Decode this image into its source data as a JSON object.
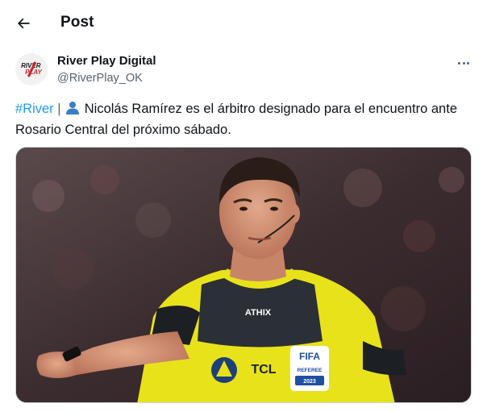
{
  "header": {
    "title": "Post",
    "back_icon": "arrow-left-icon"
  },
  "author": {
    "name": "River Play Digital",
    "handle": "@RiverPlay_OK",
    "avatar_text_line1": "RIVER",
    "avatar_text_line2": "PLAY",
    "more_icon": "more-horizontal-icon"
  },
  "tweet": {
    "hashtag": "#River",
    "separator": " | ",
    "emoji_icon": "bust-in-silhouette-icon",
    "text": " Nicolás Ramírez es el árbitro designado para el encuentro ante Rosario Central del próximo sábado."
  },
  "media": {
    "alt": "Referee photo",
    "jersey_brand": "ATHIX",
    "sponsor": "TCL",
    "badge_title": "FIFA",
    "badge_subtitle": "REFEREE",
    "badge_year": "2023"
  },
  "colors": {
    "accent": "#1d9bf0",
    "text_primary": "#0f1419",
    "text_secondary": "#536471",
    "jersey_yellow": "#e8e21a",
    "jersey_dark": "#2b3036"
  }
}
